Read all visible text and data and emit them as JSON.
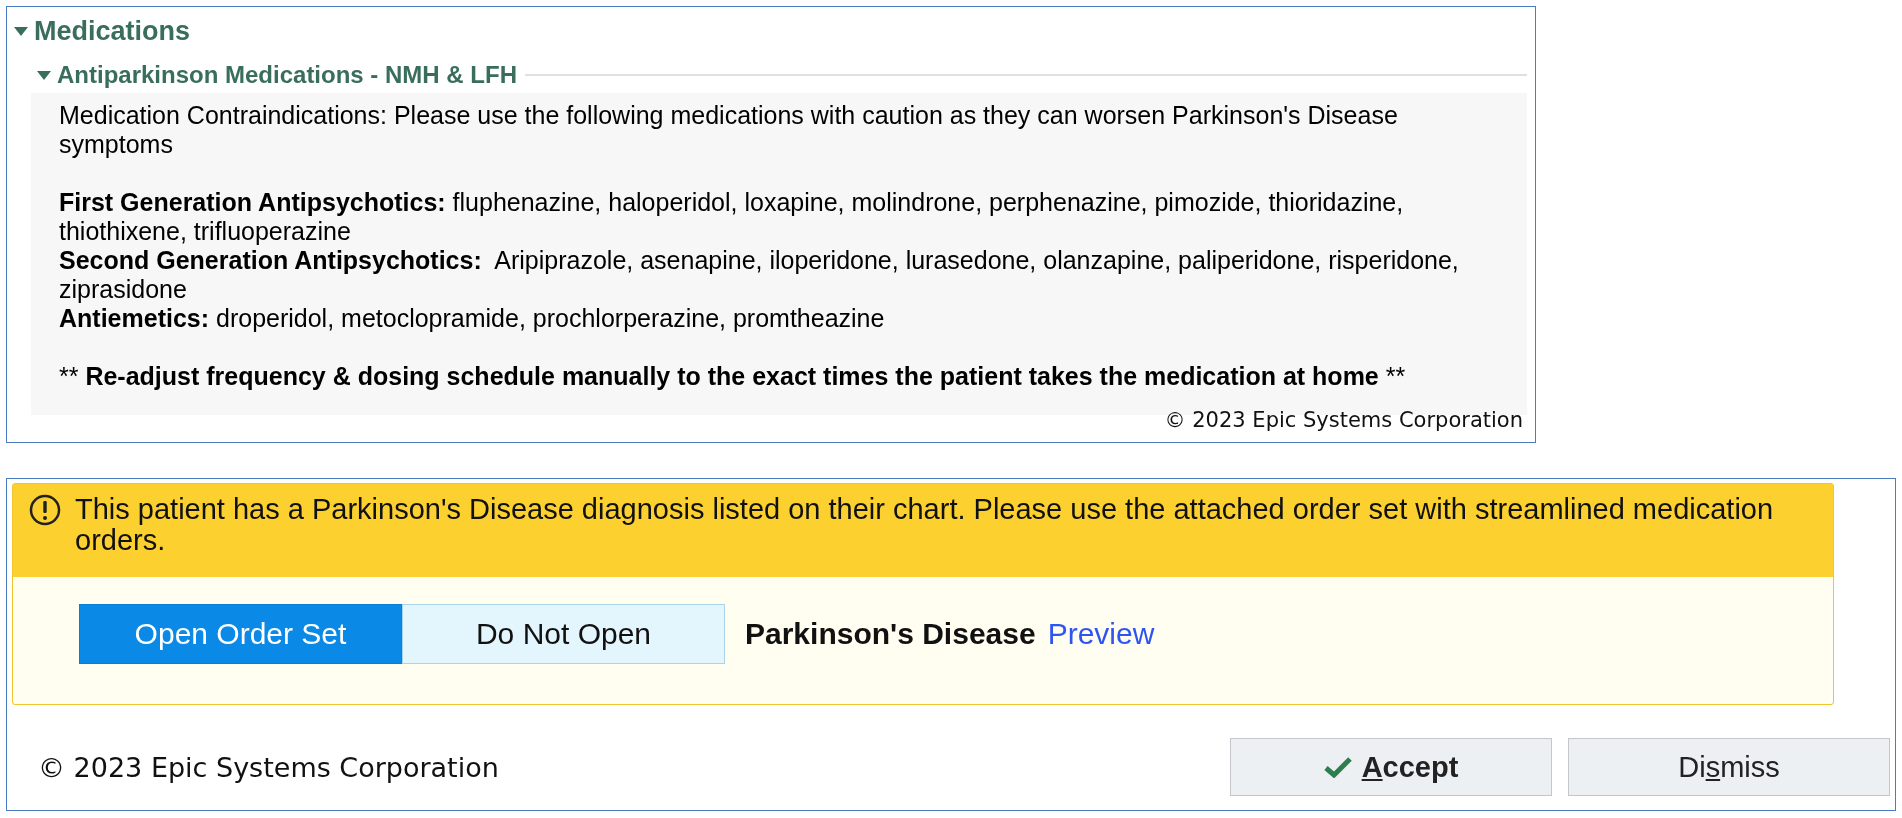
{
  "medications_panel": {
    "header": {
      "title": "Medications",
      "expanded": true
    },
    "subheader": {
      "title": "Antiparkinson Medications - NMH & LFH",
      "expanded": true
    },
    "intro": "Medication Contraindications: Please use the following medications with caution as they can worsen Parkinson's Disease symptoms",
    "groups": [
      "**First Generation Antipsychotics:** fluphenazine, haloperidol, loxapine, molindrone, perphenazine, pimozide, thioridazine, thiothixene, trifluoperazine",
      "**Second Generation Antipsychotics:**  Aripiprazole, asenapine, iloperidone, lurasedone, olanzapine, paliperidone, risperidone, ziprasidone",
      "**Antiemetics:** droperidol, metoclopramide, prochlorperazine, promtheazine"
    ],
    "note": {
      "marker_before": "**",
      "text": "Re-adjust frequency & dosing schedule manually to the exact times the patient takes the medication at home",
      "marker_after": "**"
    },
    "copyright": "© 2023 Epic Systems Corporation"
  },
  "alert_panel": {
    "message": "This patient has a Parkinson's Disease diagnosis listed on their chart. Please use the attached order set with streamlined medication orders.",
    "actions": [
      {
        "label": "Open Order Set",
        "selected": true
      },
      {
        "label": "Do Not Open",
        "selected": false
      }
    ],
    "order_set": "Parkinson's Disease",
    "link": "Preview",
    "copyright": "© 2023 Epic Systems Corporation",
    "buttons": [
      {
        "kind": "accept",
        "key": "A",
        "after": "ccept"
      },
      {
        "kind": "dismiss",
        "before": "Di",
        "key": "s",
        "after": "miss"
      }
    ]
  }
}
